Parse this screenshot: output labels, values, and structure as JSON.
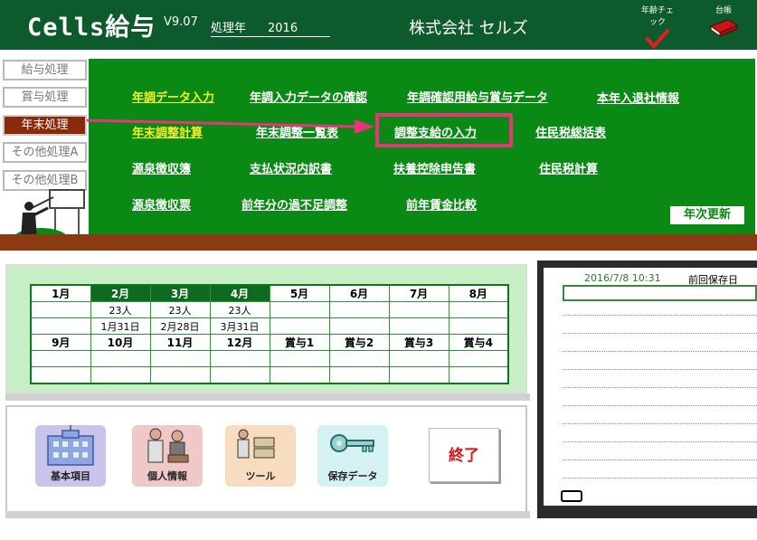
{
  "header": {
    "app_title": "Cells給与",
    "version": "V9.07",
    "year_label": "処理年",
    "year_value": "2016",
    "company": "株式会社 セルズ",
    "age_check_label": "年齢チェック",
    "ledger_label": "台帳"
  },
  "nav": [
    {
      "label": "給与処理",
      "active": false
    },
    {
      "label": "賞与処理",
      "active": false
    },
    {
      "label": "年末処理",
      "active": true
    },
    {
      "label": "その他処理A",
      "active": false
    },
    {
      "label": "その他処理B",
      "active": false
    }
  ],
  "menu": {
    "row1": [
      "年調データ入力",
      "年調入力データの確認",
      "年調確認用給与賞与データ",
      "本年入退社情報"
    ],
    "row2": [
      "年末調整計算",
      "年末調整一覧表",
      "調整支給の入力",
      "住民税総括表"
    ],
    "row3": [
      "源泉徴収簿",
      "支払状況内訳書",
      "扶養控除申告書",
      "住民税計算"
    ],
    "row4": [
      "源泉徴収票",
      "前年分の過不足調整",
      "前年賃金比較"
    ],
    "annual_update": "年次更新"
  },
  "calendar": {
    "months_row1": [
      "1月",
      "2月",
      "3月",
      "4月",
      "5月",
      "6月",
      "7月",
      "8月"
    ],
    "counts_row1": [
      "",
      "23人",
      "23人",
      "23人",
      "",
      "",
      "",
      ""
    ],
    "dates_row1": [
      "",
      "1月31日",
      "2月28日",
      "3月31日",
      "",
      "",
      "",
      ""
    ],
    "months_row2": [
      "9月",
      "10月",
      "11月",
      "12月",
      "賞与1",
      "賞与2",
      "賞与3",
      "賞与4"
    ]
  },
  "tools": {
    "basic": "基本項目",
    "personal": "個人情報",
    "tool": "ツール",
    "save": "保存データ",
    "exit": "終了"
  },
  "memo": {
    "date": "2016/7/8 10:31",
    "label": "前回保存日"
  },
  "colors": {
    "header_bg": "#0d5a2c",
    "panel_green": "#0a8a14",
    "highlight_pink": "#e8347a",
    "active_nav": "#8b2a0a",
    "yellow_link": "#f4ef2a"
  }
}
